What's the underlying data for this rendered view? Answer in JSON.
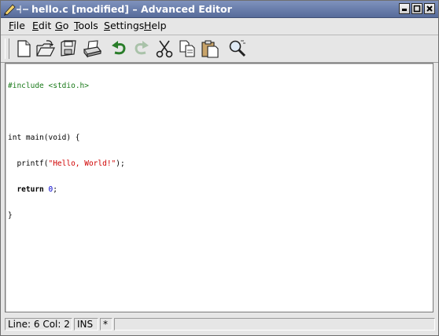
{
  "window": {
    "title": "hello.c [modified] – Advanced Editor"
  },
  "menu": {
    "items": [
      {
        "label": "File"
      },
      {
        "label": "Edit"
      },
      {
        "label": "Go"
      },
      {
        "label": "Tools"
      },
      {
        "label": "Settings"
      },
      {
        "label": "Help"
      }
    ]
  },
  "toolbar": {
    "buttons": [
      {
        "icon": "new-document-icon"
      },
      {
        "icon": "open-folder-icon"
      },
      {
        "icon": "save-disk-icon"
      },
      {
        "icon": "print-icon"
      },
      {
        "icon": "undo-icon"
      },
      {
        "icon": "redo-icon"
      },
      {
        "icon": "cut-scissors-icon"
      },
      {
        "icon": "copy-icon"
      },
      {
        "icon": "paste-icon"
      },
      {
        "icon": "find-magnifier-icon"
      }
    ]
  },
  "editor": {
    "lines": [
      "#include <stdio.h>",
      "",
      "int main(void) {",
      "  printf(\"Hello, World!\");",
      "  return 0;",
      "}"
    ],
    "tokens": {
      "include_directive": "#include",
      "include_header": "<stdio.h>",
      "main_signature": "int main(void) {",
      "printf_call_open": "  printf(",
      "string_literal": "\"Hello, World!\"",
      "printf_call_close": ");",
      "return_keyword": "return",
      "return_value": "0",
      "closing_brace": "}"
    }
  },
  "status": {
    "position": "Line: 6 Col: 2",
    "mode": "INS",
    "modified_marker": "*",
    "message": ""
  },
  "colors": {
    "titlebar_top": "#7f92bd",
    "titlebar_bottom": "#566b9a",
    "preprocessor": "#1a7a1a",
    "string": "#d00000",
    "number": "#0000cc"
  }
}
